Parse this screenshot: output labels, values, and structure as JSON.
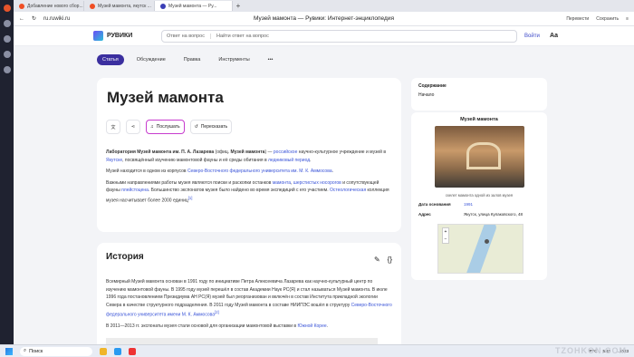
{
  "browser": {
    "tabs": [
      {
        "label": "Добавление нового сбор..."
      },
      {
        "label": "Музей мамонта, якутск ..."
      },
      {
        "label": "Музей мамонта — Ру..."
      }
    ],
    "url": "ru.ruwiki.ru",
    "page_title": "Музей мамонта — Рувики: Интернет-энциклопедия",
    "translate": "Перевести",
    "save": "Сохранить"
  },
  "site": {
    "brand": "РУВИКИ",
    "ask": "Ответ на вопрос",
    "search_placeholder": "Найти ответ на вопрос",
    "login": "Войти",
    "aa": "Аа"
  },
  "nav": {
    "items": [
      "Статья",
      "Обсуждение",
      "Правка",
      "Инструменты"
    ],
    "more": "•••"
  },
  "article": {
    "title": "Музей мамонта",
    "listen": "Послушать",
    "retell": "Пересказать",
    "p1a": "Лаборатория Музей мамонта им. П. А. Лазарева",
    "p1b": " (офиц. ",
    "p1c": "Музей мамонта",
    "p1d": ") — ",
    "p1e": "российское",
    "p1f": " научно-культурное учреждение и музей в ",
    "p1g": "Якутске",
    "p1h": ", посвящённый изучению мамонтовой фауны и её среды обитания в ",
    "p1i": "ледниковый период",
    "p1j": ".",
    "p2a": "Музей находится в одном из корпусов ",
    "p2b": "Северо-Восточного федерального университета им. М. К. Аммосова",
    "p2c": ".",
    "p3a": "Важными направлениями работы музея являются поиски и раскопки останков ",
    "p3b": "мамонта",
    "p3c": ", ",
    "p3d": "шерстистых носорогов",
    "p3e": " и сопутствующей фауны ",
    "p3f": "плейстоцена",
    "p3g": ". Большинство экспонатов музея было найдено во время экспедиций с его участием. ",
    "p3h": "Остеологическая",
    "p3i": " коллекция музея насчитывает более 2000 единиц",
    "p3j": "[1]"
  },
  "history": {
    "title": "История",
    "edit": "✎",
    "code": "{}",
    "p1": "Всемирный Музей мамонта основан в 1991 году по инициативе Петра Алексеевича Лазарева как научно-культурный центр по изучению мамонтовой фауны. В 1995 году музей перешёл в состав Академии Наук РС(Я) и стал называться Музей мамонта. В июле 1996 года постановлением Президиума АН РС(Я) музей был реорганизован и включён в состав Института прикладной экологии Севера в качестве структурного подразделения. В 2011 году Музей мамонта в составе НИИПЭС вошёл в структуру ",
    "p1link": "Северо-Восточного федерального университета имени М. К. Аммосова",
    "p1ref": "[2]",
    "p2a": "В 2011—2013 гг. экспонаты музея стали основой для организации мамонтовой выставки в ",
    "p2b": "Южной Корее",
    "p2c": "."
  },
  "toc": {
    "title": "Содержание",
    "item": "Начало"
  },
  "infobox": {
    "title": "Музей мамонта",
    "caption": "скелет мамонта одной из залов музея",
    "founded_k": "Дата основания",
    "founded_v": "1991",
    "address_k": "Адрес",
    "address_v": "Якутск, улица Кулаковского, 48"
  },
  "taskbar": {
    "search": "Поиск",
    "lang": "РУС",
    "time": "5:41",
    "date": "...2023"
  },
  "watermark": "TZOHKON.COM"
}
